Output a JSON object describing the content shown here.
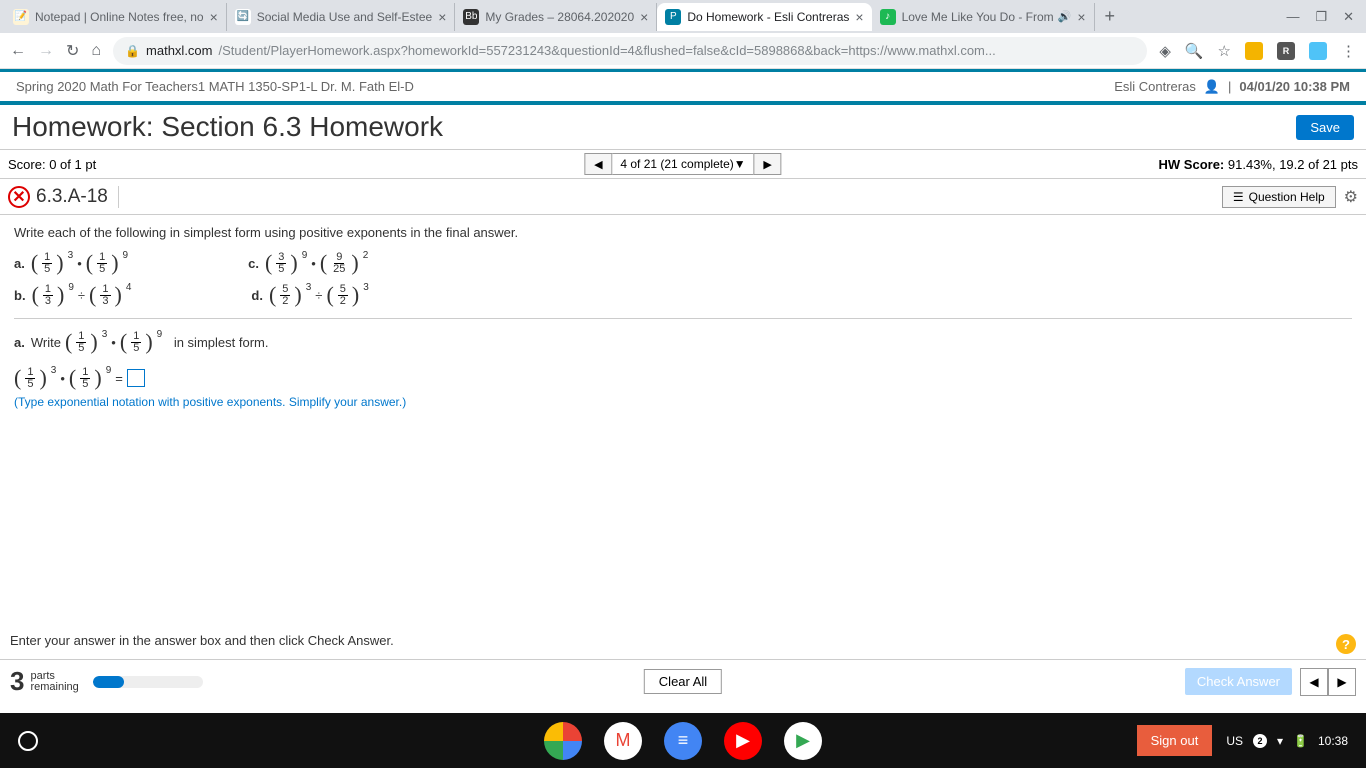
{
  "tabs": [
    {
      "title": "Notepad | Online Notes free, no",
      "icon_bg": "#fff4d6",
      "icon_txt": "📝"
    },
    {
      "title": "Social Media Use and Self-Estee",
      "icon_bg": "#fff",
      "icon_txt": "🌐"
    },
    {
      "title": "My Grades – 28064.202020",
      "icon_bg": "#333",
      "icon_txt": "Bb"
    },
    {
      "title": "Do Homework - Esli Contreras",
      "icon_bg": "#007fa3",
      "icon_txt": "P",
      "active": true
    },
    {
      "title": "Love Me Like You Do - From",
      "icon_bg": "#1db954",
      "icon_txt": "●",
      "speaker": true
    }
  ],
  "url": {
    "domain": "mathxl.com",
    "path": "/Student/PlayerHomework.aspx?homeworkId=557231243&questionId=4&flushed=false&cId=5898868&back=https://www.mathxl.com..."
  },
  "course": {
    "name": "Spring 2020 Math For Teachers1 MATH 1350-SP1-L Dr. M. Fath El-D",
    "user": "Esli Contreras",
    "datetime": "04/01/20 10:38 PM"
  },
  "homework": {
    "title": "Homework: Section 6.3 Homework",
    "save": "Save"
  },
  "score": {
    "label": "Score:",
    "value": "0 of 1 pt",
    "nav": "4 of 21 (21 complete)",
    "hwlabel": "HW Score:",
    "hwvalue": "91.43%, 19.2 of 21 pts"
  },
  "question": {
    "id": "6.3.A-18",
    "help": "Question Help"
  },
  "prompt": "Write each of the following in simplest form using positive exponents in the final answer.",
  "parts": {
    "a": {
      "f1": {
        "n": "1",
        "d": "5",
        "e": "3"
      },
      "op": "•",
      "f2": {
        "n": "1",
        "d": "5",
        "e": "9"
      }
    },
    "b": {
      "f1": {
        "n": "1",
        "d": "3",
        "e": "9"
      },
      "op": "÷",
      "f2": {
        "n": "1",
        "d": "3",
        "e": "4"
      }
    },
    "c": {
      "f1": {
        "n": "3",
        "d": "5",
        "e": "9"
      },
      "op": "•",
      "f2": {
        "n": "9",
        "d": "25",
        "e": "2"
      }
    },
    "d": {
      "f1": {
        "n": "5",
        "d": "2",
        "e": "3"
      },
      "op": "÷",
      "f2": {
        "n": "5",
        "d": "2",
        "e": "3"
      }
    }
  },
  "subq": {
    "label": "a.",
    "write": "Write",
    "tail": "in simplest form."
  },
  "hint": "(Type exponential notation with positive exponents. Simplify your answer.)",
  "footer_instruct": "Enter your answer in the answer box and then click Check Answer.",
  "bottom": {
    "count": "3",
    "parts": "parts",
    "remaining": "remaining",
    "clear": "Clear All",
    "check": "Check Answer"
  },
  "taskbar": {
    "signout": "Sign out",
    "lang": "US",
    "badge": "2",
    "time": "10:38"
  }
}
